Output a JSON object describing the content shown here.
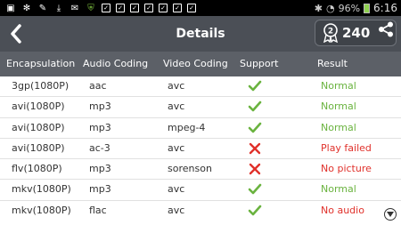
{
  "statusbar": {
    "battery_percent": "96%",
    "time": "6:16"
  },
  "header": {
    "title": "Details",
    "score": "240",
    "medal_number": "2"
  },
  "columns": {
    "encapsulation": "Encapsulation",
    "audio": "Audio Coding",
    "video": "Video Coding",
    "support": "Support",
    "result": "Result"
  },
  "rows": [
    {
      "enc": "3gp(1080P)",
      "audio": "aac",
      "video": "avc",
      "support": "check-icon",
      "result": "Normal",
      "status": "ok"
    },
    {
      "enc": "avi(1080P)",
      "audio": "mp3",
      "video": "avc",
      "support": "check-icon",
      "result": "Normal",
      "status": "ok"
    },
    {
      "enc": "avi(1080P)",
      "audio": "mp3",
      "video": "mpeg-4",
      "support": "check-icon",
      "result": "Normal",
      "status": "ok"
    },
    {
      "enc": "avi(1080P)",
      "audio": "ac-3",
      "video": "avc",
      "support": "cross-icon",
      "result": "Play failed",
      "status": "bad"
    },
    {
      "enc": "flv(1080P)",
      "audio": "mp3",
      "video": "sorenson",
      "support": "cross-icon",
      "result": "No picture",
      "status": "bad"
    },
    {
      "enc": "mkv(1080P)",
      "audio": "mp3",
      "video": "avc",
      "support": "check-icon",
      "result": "Normal",
      "status": "ok"
    },
    {
      "enc": "mkv(1080P)",
      "audio": "flac",
      "video": "avc",
      "support": "check-icon",
      "result": "No audio",
      "status": "bad"
    }
  ],
  "colors": {
    "header_bg": "#4b4f56",
    "colhead_bg": "#5c6067",
    "ok": "#6ab33f",
    "bad": "#e0312b"
  }
}
